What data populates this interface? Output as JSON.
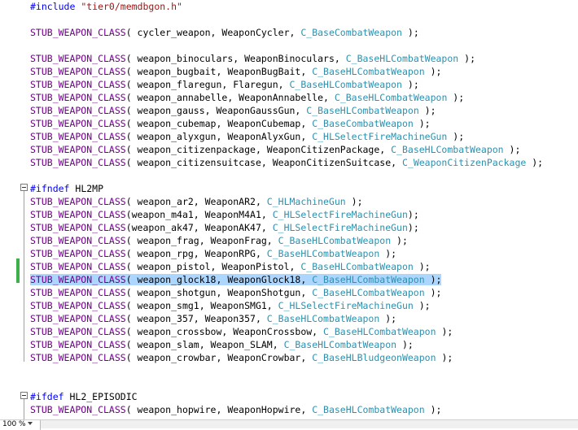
{
  "editor": {
    "zoom_level": "100 %",
    "lines": [
      {
        "row": 0,
        "tokens": [
          [
            "directive",
            "#include "
          ],
          [
            "string",
            "\"tier0/memdbgon.h\""
          ]
        ]
      },
      {
        "row": 2,
        "tokens": [
          [
            "macro",
            "STUB_WEAPON_CLASS"
          ],
          [
            "plain",
            "( cycler_weapon, WeaponCycler, "
          ],
          [
            "type",
            "C_BaseCombatWeapon"
          ],
          [
            "plain",
            " );"
          ]
        ]
      },
      {
        "row": 4,
        "tokens": [
          [
            "macro",
            "STUB_WEAPON_CLASS"
          ],
          [
            "plain",
            "( weapon_binoculars, WeaponBinoculars, "
          ],
          [
            "type",
            "C_BaseHLCombatWeapon"
          ],
          [
            "plain",
            " );"
          ]
        ]
      },
      {
        "row": 5,
        "tokens": [
          [
            "macro",
            "STUB_WEAPON_CLASS"
          ],
          [
            "plain",
            "( weapon_bugbait, WeaponBugBait, "
          ],
          [
            "type",
            "C_BaseHLCombatWeapon"
          ],
          [
            "plain",
            " );"
          ]
        ]
      },
      {
        "row": 6,
        "tokens": [
          [
            "macro",
            "STUB_WEAPON_CLASS"
          ],
          [
            "plain",
            "( weapon_flaregun, Flaregun, "
          ],
          [
            "type",
            "C_BaseHLCombatWeapon"
          ],
          [
            "plain",
            " );"
          ]
        ]
      },
      {
        "row": 7,
        "tokens": [
          [
            "macro",
            "STUB_WEAPON_CLASS"
          ],
          [
            "plain",
            "( weapon_annabelle, WeaponAnnabelle, "
          ],
          [
            "type",
            "C_BaseHLCombatWeapon"
          ],
          [
            "plain",
            " );"
          ]
        ]
      },
      {
        "row": 8,
        "tokens": [
          [
            "macro",
            "STUB_WEAPON_CLASS"
          ],
          [
            "plain",
            "( weapon_gauss, WeaponGaussGun, "
          ],
          [
            "type",
            "C_BaseHLCombatWeapon"
          ],
          [
            "plain",
            " );"
          ]
        ]
      },
      {
        "row": 9,
        "tokens": [
          [
            "macro",
            "STUB_WEAPON_CLASS"
          ],
          [
            "plain",
            "( weapon_cubemap, WeaponCubemap, "
          ],
          [
            "type",
            "C_BaseCombatWeapon"
          ],
          [
            "plain",
            " );"
          ]
        ]
      },
      {
        "row": 10,
        "tokens": [
          [
            "macro",
            "STUB_WEAPON_CLASS"
          ],
          [
            "plain",
            "( weapon_alyxgun, WeaponAlyxGun, "
          ],
          [
            "type",
            "C_HLSelectFireMachineGun"
          ],
          [
            "plain",
            " );"
          ]
        ]
      },
      {
        "row": 11,
        "tokens": [
          [
            "macro",
            "STUB_WEAPON_CLASS"
          ],
          [
            "plain",
            "( weapon_citizenpackage, WeaponCitizenPackage, "
          ],
          [
            "type",
            "C_BaseHLCombatWeapon"
          ],
          [
            "plain",
            " );"
          ]
        ]
      },
      {
        "row": 12,
        "tokens": [
          [
            "macro",
            "STUB_WEAPON_CLASS"
          ],
          [
            "plain",
            "( weapon_citizensuitcase, WeaponCitizenSuitcase, "
          ],
          [
            "type",
            "C_WeaponCitizenPackage"
          ],
          [
            "plain",
            " );"
          ]
        ]
      },
      {
        "row": 14,
        "tokens": [
          [
            "directive",
            "#ifndef"
          ],
          [
            "plain",
            " HL2MP"
          ]
        ]
      },
      {
        "row": 15,
        "tokens": [
          [
            "macro",
            "STUB_WEAPON_CLASS"
          ],
          [
            "plain",
            "( weapon_ar2, WeaponAR2, "
          ],
          [
            "type",
            "C_HLMachineGun"
          ],
          [
            "plain",
            " );"
          ]
        ]
      },
      {
        "row": 16,
        "tokens": [
          [
            "macro",
            "STUB_WEAPON_CLASS"
          ],
          [
            "plain",
            "(weapon_m4a1, WeaponM4A1, "
          ],
          [
            "type",
            "C_HLSelectFireMachineGun"
          ],
          [
            "plain",
            ");"
          ]
        ]
      },
      {
        "row": 17,
        "tokens": [
          [
            "macro",
            "STUB_WEAPON_CLASS"
          ],
          [
            "plain",
            "(weapon_ak47, WeaponAK47, "
          ],
          [
            "type",
            "C_HLSelectFireMachineGun"
          ],
          [
            "plain",
            ");"
          ]
        ]
      },
      {
        "row": 18,
        "tokens": [
          [
            "macro",
            "STUB_WEAPON_CLASS"
          ],
          [
            "plain",
            "( weapon_frag, WeaponFrag, "
          ],
          [
            "type",
            "C_BaseHLCombatWeapon"
          ],
          [
            "plain",
            " );"
          ]
        ]
      },
      {
        "row": 19,
        "tokens": [
          [
            "macro",
            "STUB_WEAPON_CLASS"
          ],
          [
            "plain",
            "( weapon_rpg, WeaponRPG, "
          ],
          [
            "type",
            "C_BaseHLCombatWeapon"
          ],
          [
            "plain",
            " );"
          ]
        ]
      },
      {
        "row": 20,
        "tokens": [
          [
            "macro",
            "STUB_WEAPON_CLASS"
          ],
          [
            "plain",
            "( weapon_pistol, WeaponPistol, "
          ],
          [
            "type",
            "C_BaseHLCombatWeapon"
          ],
          [
            "plain",
            " );"
          ]
        ]
      },
      {
        "row": 21,
        "selected": true,
        "tokens": [
          [
            "macro",
            "STUB_WEAPON_CLASS"
          ],
          [
            "plain",
            "( weapon_glock18, WeaponGlock18, "
          ],
          [
            "type",
            "C_BaseHLCombatWeapon"
          ],
          [
            "plain",
            " );"
          ]
        ]
      },
      {
        "row": 22,
        "tokens": [
          [
            "macro",
            "STUB_WEAPON_CLASS"
          ],
          [
            "plain",
            "( weapon_shotgun, WeaponShotgun, "
          ],
          [
            "type",
            "C_BaseHLCombatWeapon"
          ],
          [
            "plain",
            " );"
          ]
        ]
      },
      {
        "row": 23,
        "tokens": [
          [
            "macro",
            "STUB_WEAPON_CLASS"
          ],
          [
            "plain",
            "( weapon_smg1, WeaponSMG1, "
          ],
          [
            "type",
            "C_HLSelectFireMachineGun"
          ],
          [
            "plain",
            " );"
          ]
        ]
      },
      {
        "row": 24,
        "tokens": [
          [
            "macro",
            "STUB_WEAPON_CLASS"
          ],
          [
            "plain",
            "( weapon_357, Weapon357, "
          ],
          [
            "type",
            "C_BaseHLCombatWeapon"
          ],
          [
            "plain",
            " );"
          ]
        ]
      },
      {
        "row": 25,
        "tokens": [
          [
            "macro",
            "STUB_WEAPON_CLASS"
          ],
          [
            "plain",
            "( weapon_crossbow, WeaponCrossbow, "
          ],
          [
            "type",
            "C_BaseHLCombatWeapon"
          ],
          [
            "plain",
            " );"
          ]
        ]
      },
      {
        "row": 26,
        "tokens": [
          [
            "macro",
            "STUB_WEAPON_CLASS"
          ],
          [
            "plain",
            "( weapon_slam, Weapon_SLAM, "
          ],
          [
            "type",
            "C_BaseHLCombatWeapon"
          ],
          [
            "plain",
            " );"
          ]
        ]
      },
      {
        "row": 27,
        "tokens": [
          [
            "macro",
            "STUB_WEAPON_CLASS"
          ],
          [
            "plain",
            "( weapon_crowbar, WeaponCrowbar, "
          ],
          [
            "type",
            "C_BaseHLBludgeonWeapon"
          ],
          [
            "plain",
            " );"
          ]
        ]
      },
      {
        "row": 30,
        "tokens": [
          [
            "directive",
            "#ifdef"
          ],
          [
            "plain",
            " HL2_EPISODIC"
          ]
        ]
      },
      {
        "row": 31,
        "tokens": [
          [
            "macro",
            "STUB_WEAPON_CLASS"
          ],
          [
            "plain",
            "( weapon_hopwire, WeaponHopwire, "
          ],
          [
            "type",
            "C_BaseHLCombatWeapon"
          ],
          [
            "plain",
            " );"
          ]
        ]
      }
    ]
  },
  "colors": {
    "macro": "#6f008a",
    "directive": "#0000ff",
    "string": "#a31515",
    "type": "#2b91af",
    "selection": "#add6ff",
    "change_marker": "#3cb14a"
  },
  "icons": [
    "collapse-minus-icon",
    "dropdown-arrow-icon"
  ]
}
